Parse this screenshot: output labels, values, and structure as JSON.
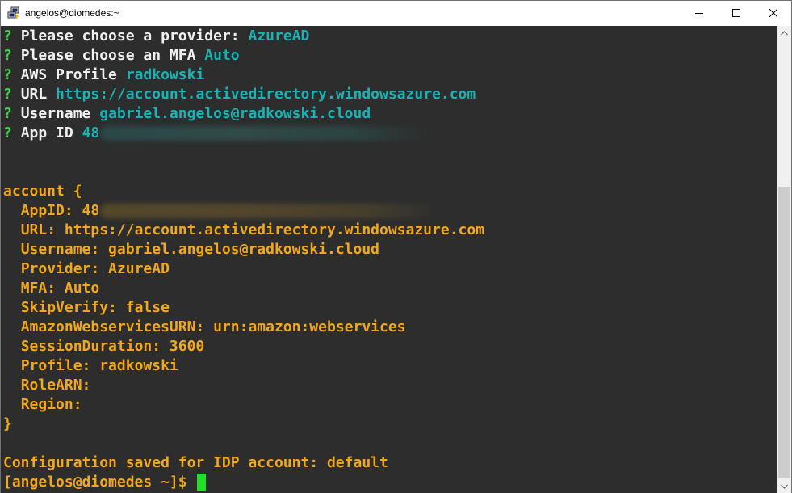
{
  "window": {
    "title": "angelos@diomedes:~",
    "icon": "putty-icon"
  },
  "prompts": [
    {
      "mark": "?",
      "label": "Please choose a provider:",
      "value": "AzureAD"
    },
    {
      "mark": "?",
      "label": "Please choose an MFA",
      "value": "Auto"
    },
    {
      "mark": "?",
      "label": "AWS Profile",
      "value": "radkowski"
    },
    {
      "mark": "?",
      "label": "URL",
      "value": "https://account.activedirectory.windowsazure.com"
    },
    {
      "mark": "?",
      "label": "Username",
      "value": "gabriel.angelos@radkowski.cloud"
    },
    {
      "mark": "?",
      "label": "App ID",
      "value": "48"
    }
  ],
  "account": {
    "open": "account {",
    "fields": [
      "AppID: 48",
      "URL: https://account.activedirectory.windowsazure.com",
      "Username: gabriel.angelos@radkowski.cloud",
      "Provider: AzureAD",
      "MFA: Auto",
      "SkipVerify: false",
      "AmazonWebservicesURN: urn:amazon:webservices",
      "SessionDuration: 3600",
      "Profile: radkowski",
      "RoleARN:",
      "Region:"
    ],
    "close": "}"
  },
  "status_message": "Configuration saved for IDP account: default",
  "shell_prompt": "[angelos@diomedes ~]$",
  "colors": {
    "background": "#2d2d2d",
    "question_mark": "#3fd13f",
    "prompt_text": "#f0f0f0",
    "answer": "#1ab3b3",
    "output": "#f0a81e",
    "cursor": "#22e022"
  }
}
